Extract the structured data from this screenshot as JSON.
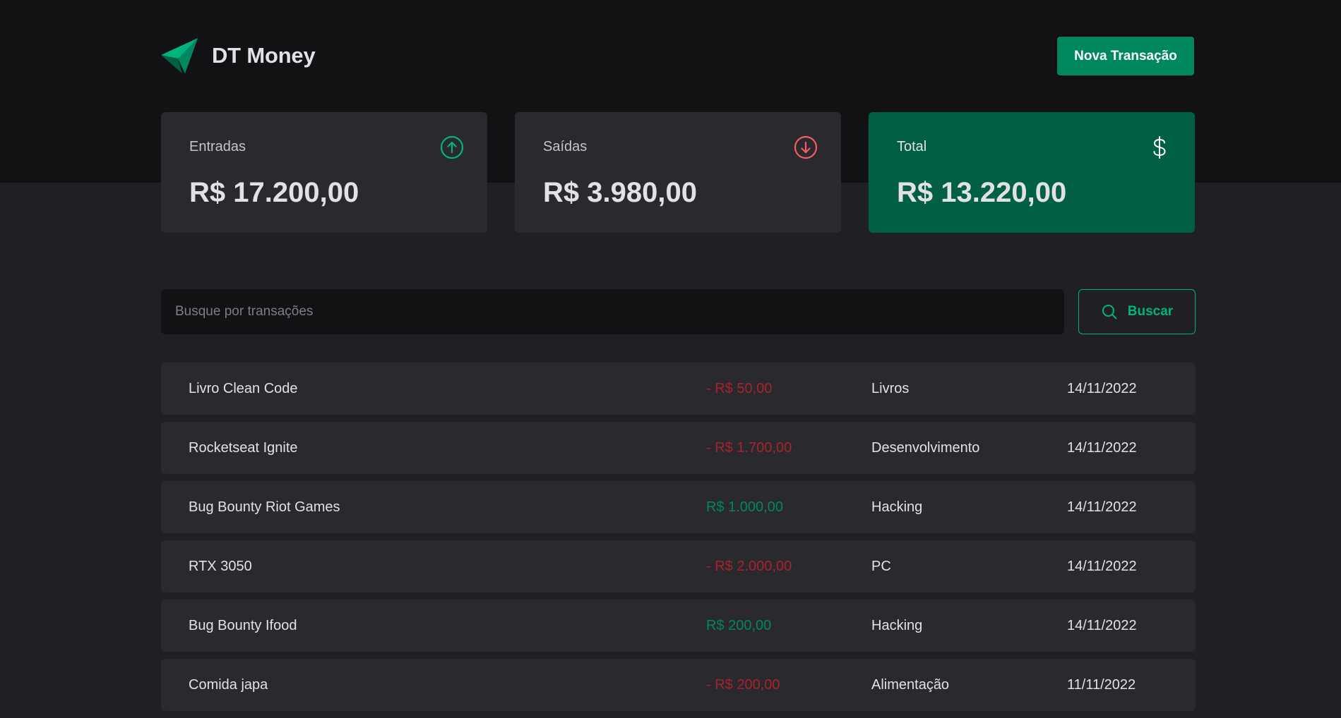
{
  "app": {
    "name": "DT Money",
    "logo_icon": "paper-plane-logo-icon"
  },
  "header": {
    "new_transaction_label": "Nova Transação"
  },
  "summary": {
    "income": {
      "label": "Entradas",
      "value": "R$ 17.200,00",
      "icon": "arrow-circle-up-icon",
      "icon_color": "#00B37E"
    },
    "outcome": {
      "label": "Saídas",
      "value": "R$ 3.980,00",
      "icon": "arrow-circle-down-icon",
      "icon_color": "#F75A68"
    },
    "total": {
      "label": "Total",
      "value": "R$ 13.220,00",
      "icon": "currency-dollar-icon",
      "background": "#015F43"
    }
  },
  "search": {
    "placeholder": "Busque por transações",
    "value": "",
    "button_label": "Buscar",
    "icon": "magnifying-glass-icon"
  },
  "transactions": [
    {
      "description": "Livro Clean Code",
      "price": "- R$ 50,00",
      "type": "outcome",
      "category": "Livros",
      "date": "14/11/2022"
    },
    {
      "description": "Rocketseat Ignite",
      "price": "- R$ 1.700,00",
      "type": "outcome",
      "category": "Desenvolvimento",
      "date": "14/11/2022"
    },
    {
      "description": "Bug Bounty Riot Games",
      "price": "R$ 1.000,00",
      "type": "income",
      "category": "Hacking",
      "date": "14/11/2022"
    },
    {
      "description": "RTX 3050",
      "price": "- R$ 2.000,00",
      "type": "outcome",
      "category": "PC",
      "date": "14/11/2022"
    },
    {
      "description": "Bug Bounty Ifood",
      "price": "R$ 200,00",
      "type": "income",
      "category": "Hacking",
      "date": "14/11/2022"
    },
    {
      "description": "Comida japa",
      "price": "- R$ 200,00",
      "type": "outcome",
      "category": "Alimentação",
      "date": "11/11/2022"
    }
  ],
  "colors": {
    "background": "#202024",
    "header_background": "#121214",
    "card_background": "#29292E",
    "brand_green": "#00875F",
    "light_green": "#00B37E",
    "red": "#AB222E"
  }
}
